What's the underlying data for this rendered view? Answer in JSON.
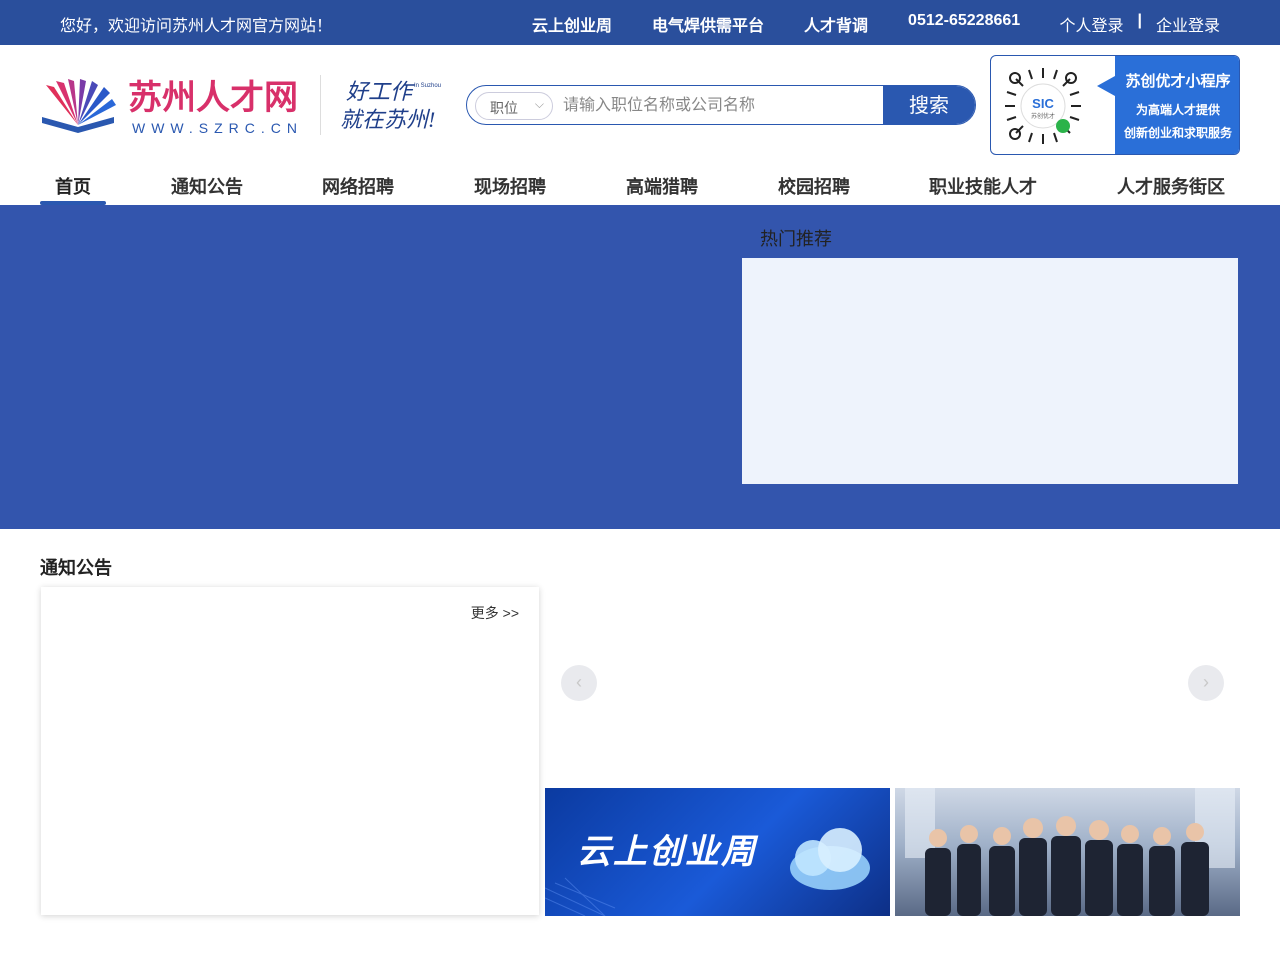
{
  "topbar": {
    "welcome": "您好，欢迎访问苏州人才网官方网站！",
    "links": [
      "云上创业周",
      "电气焊供需平台",
      "人才背调",
      "0512-65228661"
    ],
    "personal_login": "个人登录",
    "separator": "|",
    "company_login": "企业登录"
  },
  "logo": {
    "brand": "苏州人才网",
    "url": "WWW.SZRC.CN",
    "slogan_line1": "好工作",
    "slogan_line2": "就在苏州!",
    "slogan_small": "In Suzhou"
  },
  "search": {
    "type_label": "职位",
    "placeholder": "请输入职位名称或公司名称",
    "button": "搜索"
  },
  "miniprogram": {
    "title": "苏创优才小程序",
    "line1": "为高端人才提供",
    "line2": "创新创业和求职服务",
    "qr_label": "SIC",
    "qr_sub": "苏创优才"
  },
  "nav": {
    "items": [
      "首页",
      "通知公告",
      "网络招聘",
      "现场招聘",
      "高端猎聘",
      "校园招聘",
      "职业技能人才",
      "人才服务街区"
    ],
    "active_index": 0
  },
  "banner": {
    "hot_title": "热门推荐"
  },
  "notice": {
    "title": "通知公告",
    "more": "更多 >>"
  },
  "carousel": {
    "prev": "‹",
    "next": "›"
  },
  "promos": {
    "cloud_week": "云上创业周"
  },
  "colors": {
    "topbar": "#2a4f9c",
    "banner": "#3355ad",
    "accent": "#2a58b0"
  }
}
